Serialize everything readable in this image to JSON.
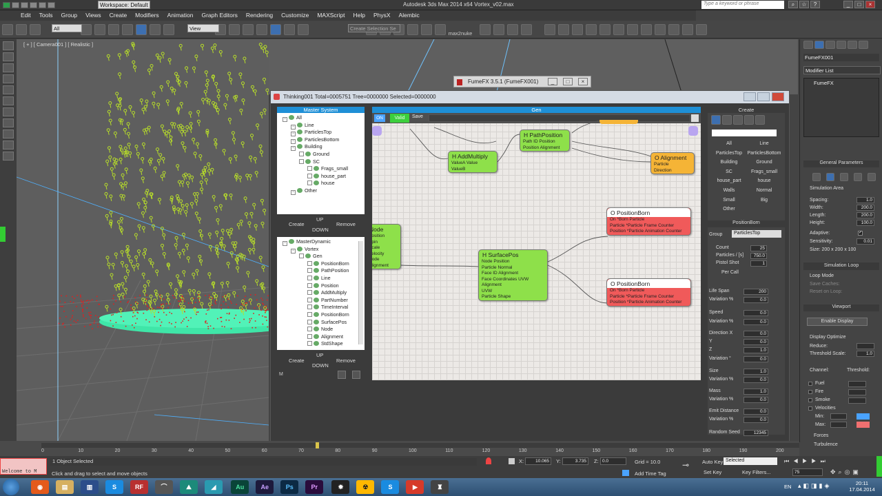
{
  "window_title": "Autodesk 3ds Max 2014 x64     Vortex_v02.max",
  "workspace": "Workspace: Default",
  "search_placeholder": "Type a keyword or phrase",
  "menu": [
    "Edit",
    "Tools",
    "Group",
    "Views",
    "Create",
    "Modifiers",
    "Animation",
    "Graph Editors",
    "Rendering",
    "Customize",
    "MAXScript",
    "Help",
    "PhysX",
    "Alembic"
  ],
  "toolbar": {
    "selection_filter": "All",
    "ref_coord": "View",
    "named_selection": "Create Selection Se",
    "max2nuke": "max2nuke"
  },
  "viewport_label": "[ + ] [ Camera001 ] [ Realistic ]",
  "fumefx_window": "FumeFX 3.5.1 (FumeFX001)",
  "thinking": {
    "title": "Thinking001  Total=0005751  Tree=0000000  Selected=0000000",
    "master_system": {
      "header": "Master System",
      "items": [
        {
          "label": "All",
          "level": 0
        },
        {
          "label": "Line",
          "level": 1
        },
        {
          "label": "ParticlesTop",
          "level": 1
        },
        {
          "label": "ParticlesBottom",
          "level": 1
        },
        {
          "label": "Building",
          "level": 1
        },
        {
          "label": "Ground",
          "level": 2
        },
        {
          "label": "SC",
          "level": 2
        },
        {
          "label": "Frags_small",
          "level": 3
        },
        {
          "label": "house_part",
          "level": 3
        },
        {
          "label": "house",
          "level": 3
        },
        {
          "label": "Other",
          "level": 1
        }
      ]
    },
    "buttons_top": {
      "up": "UP",
      "create": "Create",
      "remove": "Remove",
      "down": "DOWN"
    },
    "master_dynamic": {
      "header": "MasterDynamic",
      "items": [
        {
          "label": "MasterDynamic",
          "level": 0
        },
        {
          "label": "Vortex",
          "level": 1
        },
        {
          "label": "Gen",
          "level": 2
        },
        {
          "label": "PositionBorn",
          "level": 3
        },
        {
          "label": "PathPosition",
          "level": 3
        },
        {
          "label": "Line",
          "level": 3
        },
        {
          "label": "Position",
          "level": 3
        },
        {
          "label": "AddMultiply",
          "level": 3
        },
        {
          "label": "PartNumber",
          "level": 3
        },
        {
          "label": "TimeInterval",
          "level": 3
        },
        {
          "label": "PositionBorn",
          "level": 3
        },
        {
          "label": "SurfacePos",
          "level": 3
        },
        {
          "label": "Node",
          "level": 3
        },
        {
          "label": "Alignment",
          "level": 3
        },
        {
          "label": "StdShape",
          "level": 3
        }
      ]
    },
    "buttons_bottom": {
      "up": "UP",
      "create": "Create",
      "remove": "Remove",
      "down": "DOWN"
    },
    "m_button": "M",
    "graph": {
      "header": "Gen",
      "on": "ON",
      "valid": "Valid",
      "save": "Save",
      "nodes": [
        {
          "title": "H PathPosition",
          "rows": [
            "Path ID    Position",
            "Position   Alignment"
          ]
        },
        {
          "title": "H AddMultiply",
          "rows": [
            "ValueA   Value",
            "ValueB"
          ]
        },
        {
          "title": "O Alignment",
          "rows": [
            "Particle",
            "Direction"
          ]
        },
        {
          "title": "Node",
          "rows": [
            "Position",
            "Spin",
            "Scale",
            "Velocity",
            "Node",
            "Alignment"
          ]
        },
        {
          "title": "O PositionBorn",
          "rows": [
            "On          *Born Particle",
            "Particle    *Particle Frame Counter",
            "Position    *Particle Animation Counter"
          ]
        },
        {
          "title": "H SurfacePos",
          "rows": [
            "Node                 Position",
            "Particle             Normal",
            "Face ID              Alignment",
            "Face Coordinates     UVW",
            "Alignment",
            "UVW",
            "Particle Shape"
          ]
        },
        {
          "title": "O PositionBorn",
          "rows": [
            "On          *Born Particle",
            "Particle    *Particle Frame Counter",
            "Position    *Particle Animation Counter"
          ]
        }
      ]
    },
    "create_panel": {
      "header": "Create",
      "groups": [
        [
          "All",
          "Line"
        ],
        [
          "ParticlesTop",
          "ParticlesBottom"
        ],
        [
          "Building",
          "Ground"
        ],
        [
          "SC",
          "Frags_small"
        ],
        [
          "house_part",
          "house"
        ],
        [
          "Walls",
          "Normal"
        ],
        [
          "Small",
          "Big"
        ],
        [
          "Other",
          ""
        ]
      ],
      "section": "PositionBorn",
      "group_label": "Group",
      "group_value": "ParticlesTop",
      "count_label": "Count",
      "count": "25",
      "particles_label": "Particles / [s]",
      "particles": "750.0",
      "pistol_label": "Pistol Shot",
      "pistol": "1",
      "per_call": "Per Call",
      "params": [
        [
          "Life Span",
          "200"
        ],
        [
          "Variation  %",
          "0.0"
        ],
        [
          "Speed",
          "0.0"
        ],
        [
          "Variation  %",
          "0.0"
        ],
        [
          "Direction  X",
          "0.0"
        ],
        [
          "Y",
          "0.0"
        ],
        [
          "Z",
          "1.0"
        ],
        [
          "Variation  °",
          "0.0"
        ],
        [
          "Size",
          "1.0"
        ],
        [
          "Variation  %",
          "0.0"
        ],
        [
          "Mass",
          "1.0"
        ],
        [
          "Variation  %",
          "0.0"
        ],
        [
          "Emit Distance",
          "0.0"
        ],
        [
          "Variation  %",
          "0.0"
        ],
        [
          "Random Seed",
          "12345"
        ]
      ]
    }
  },
  "command_panel": {
    "object_name": "FumeFX001",
    "modifier_list": "Modifier List",
    "stack_item": "FumeFX",
    "general_params": "General Parameters",
    "sim_area": "Simulation Area",
    "spacing": [
      "Spacing:",
      "1.0"
    ],
    "width": [
      "Width:",
      "200.0"
    ],
    "length": [
      "Length:",
      "200.0"
    ],
    "height": [
      "Height:",
      "100.0"
    ],
    "adaptive": "Adaptive:",
    "sensitivity": [
      "Sensitivity:",
      "0.01"
    ],
    "size": "Size: 200 x 200 x 100",
    "sim_loop": "Simulation Loop",
    "loop_mode": "Loop Mode",
    "save_caches": "Save Caches:",
    "reset_loop": "Reset on Loop:",
    "viewport": "Viewport",
    "enable_display": "Enable Display",
    "display_opt": "Display Optimize",
    "reduce": "Reduce:",
    "threshold_scale": [
      "Threshold Scale:",
      "1.0"
    ],
    "channel": "Channel:",
    "threshold": "Threshold:",
    "channels": [
      "Fuel",
      "Fire",
      "Smoke",
      "Velocities"
    ],
    "min": "Min:",
    "max": "Max:",
    "forces": "Forces",
    "turbulence": "Turbulence",
    "accent_blue": "#4aa3ff",
    "accent_red": "#f07070"
  },
  "timeline": {
    "frame": "70 / 200",
    "ticks": [
      "0",
      "10",
      "20",
      "30",
      "40",
      "50",
      "60",
      "70",
      "80",
      "90",
      "100",
      "110",
      "120",
      "130",
      "140",
      "150",
      "160",
      "170",
      "180",
      "190",
      "200"
    ]
  },
  "status": {
    "maxscript": "Welcome to M",
    "selected": "1 Object Selected",
    "prompt": "Click and drag to select and move objects",
    "x_label": "X:",
    "x": "10.065",
    "y_label": "Y:",
    "y": "3.735",
    "z_label": "Z:",
    "z": "0.0",
    "grid": "Grid = 10.0",
    "add_time_tag": "Add Time Tag",
    "auto_key": "Auto Key",
    "auto_key_value": "Selected",
    "set_key": "Set Key",
    "key_filters": "Key Filters...",
    "frame_value": "75"
  },
  "taskbar": {
    "apps": [
      "Au",
      "Ae",
      "Ps",
      "Pr"
    ],
    "lang": "EN",
    "time": "20:11",
    "date": "17.04.2014"
  }
}
